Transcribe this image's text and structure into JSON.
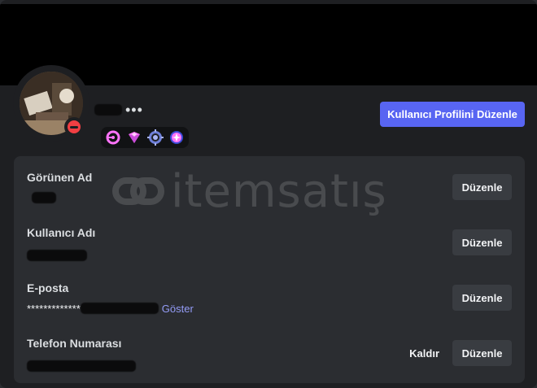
{
  "profile": {
    "more_indicator": "•••",
    "edit_profile_label": "Kullanıcı Profilini Düzenle",
    "status": "do-not-disturb",
    "status_color": "#f23f43",
    "accent_color": "#5865f2",
    "badges": [
      "nitro-badge-icon",
      "boost-gem-badge-icon",
      "hypesquad-badge-icon",
      "quest-badge-icon"
    ]
  },
  "account_fields": [
    {
      "label": "Görünen Ad",
      "action_label": "Düzenle"
    },
    {
      "label": "Kullanıcı Adı",
      "action_label": "Düzenle"
    },
    {
      "label": "E-posta",
      "masked_prefix": "*************",
      "show_label": "Göster",
      "action_label": "Düzenle"
    },
    {
      "label": "Telefon Numarası",
      "remove_label": "Kaldır",
      "action_label": "Düzenle"
    }
  ],
  "watermark": {
    "text": "itemsatış"
  }
}
